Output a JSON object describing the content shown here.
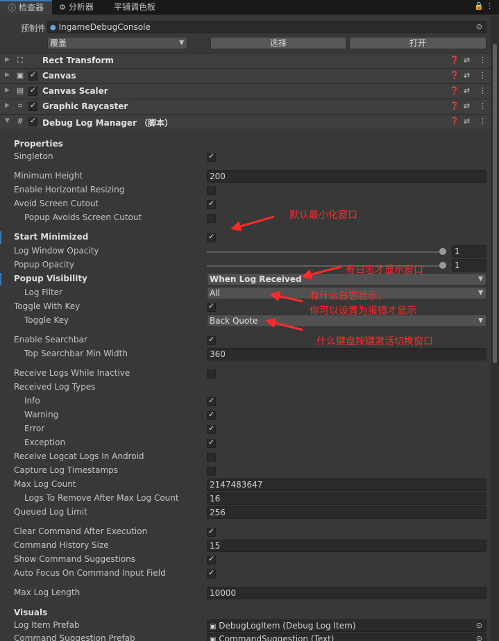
{
  "tabs": [
    {
      "label": "检查器",
      "icon": "inspector-icon"
    },
    {
      "label": "分析器",
      "icon": "analyzer-icon"
    },
    {
      "label": "平铺调色板",
      "icon": ""
    }
  ],
  "window_controls": {
    "lock": "🔒",
    "menu": "⋮"
  },
  "prefab": {
    "label": "预制件",
    "name": "IngameDebugConsole",
    "overrides_dropdown": "覆盖",
    "select_button": "选择",
    "open_button": "打开"
  },
  "components": [
    {
      "name": "Rect Transform",
      "checkbox": false,
      "icon": "rect-transform-icon"
    },
    {
      "name": "Canvas",
      "checkbox": true,
      "icon": "canvas-icon"
    },
    {
      "name": "Canvas Scaler",
      "checkbox": true,
      "icon": "canvas-scaler-icon"
    },
    {
      "name": "Graphic Raycaster",
      "checkbox": true,
      "icon": "graphic-raycaster-icon"
    },
    {
      "name": "Debug Log Manager （脚本）",
      "checkbox": true,
      "icon": "script-icon"
    }
  ],
  "properties": {
    "header": "Properties",
    "singleton": {
      "label": "Singleton",
      "checked": true
    },
    "minimum_height": {
      "label": "Minimum Height",
      "value": "200"
    },
    "enable_horizontal_resizing": {
      "label": "Enable Horizontal Resizing",
      "checked": false
    },
    "avoid_screen_cutout": {
      "label": "Avoid Screen Cutout",
      "checked": true
    },
    "popup_avoids_screen_cutout": {
      "label": "Popup Avoids Screen Cutout",
      "checked": false
    },
    "start_minimized": {
      "label": "Start Minimized",
      "checked": true
    },
    "log_window_opacity": {
      "label": "Log Window Opacity",
      "value": "1",
      "slider_fraction": 1.0
    },
    "popup_opacity": {
      "label": "Popup Opacity",
      "value": "1",
      "slider_fraction": 1.0
    },
    "popup_visibility": {
      "label": "Popup Visibility",
      "value": "When Log Received"
    },
    "log_filter": {
      "label": "Log Filter",
      "value": "All"
    },
    "toggle_with_key": {
      "label": "Toggle With Key",
      "checked": true
    },
    "toggle_key": {
      "label": "Toggle Key",
      "value": "Back Quote"
    },
    "enable_searchbar": {
      "label": "Enable Searchbar",
      "checked": true
    },
    "top_searchbar_min_width": {
      "label": "Top Searchbar Min Width",
      "value": "360"
    },
    "receive_logs_while_inactive": {
      "label": "Receive Logs While Inactive",
      "checked": false
    },
    "received_log_types": {
      "label": "Received Log Types"
    },
    "info": {
      "label": "Info",
      "checked": true
    },
    "warning": {
      "label": "Warning",
      "checked": true
    },
    "error": {
      "label": "Error",
      "checked": true
    },
    "exception": {
      "label": "Exception",
      "checked": true
    },
    "receive_logcat_logs": {
      "label": "Receive Logcat Logs In Android",
      "checked": false
    },
    "capture_log_timestamps": {
      "label": "Capture Log Timestamps",
      "checked": false
    },
    "max_log_count": {
      "label": "Max Log Count",
      "value": "2147483647"
    },
    "logs_to_remove": {
      "label": "Logs To Remove After Max Log Count",
      "value": "16"
    },
    "queued_log_limit": {
      "label": "Queued Log Limit",
      "value": "256"
    },
    "clear_command_after_execution": {
      "label": "Clear Command After Execution",
      "checked": true
    },
    "command_history_size": {
      "label": "Command History Size",
      "value": "15"
    },
    "show_command_suggestions": {
      "label": "Show Command Suggestions",
      "checked": true
    },
    "auto_focus_command_input": {
      "label": "Auto Focus On Command Input Field",
      "checked": true
    },
    "max_log_length": {
      "label": "Max Log Length",
      "value": "10000"
    }
  },
  "visuals": {
    "header": "Visuals",
    "log_item_prefab": {
      "label": "Log Item Prefab",
      "value": "DebugLogItem (Debug Log Item)"
    },
    "command_suggestion_prefab": {
      "label": "Command Suggestion Prefab",
      "value": "CommandSuggestion (Text)"
    }
  },
  "annotations": {
    "start_minimized": "默认最小化窗口",
    "popup_visibility": "有日志才显示窗口",
    "log_filter_line1": "有什么日志显示，",
    "log_filter_line2": "你可以设置为报错才显示",
    "toggle_key": "什么键盘按键激活切换窗口"
  },
  "colors": {
    "annotation": "#ff2a2a",
    "accent": "#3a79bb",
    "background": "#383838"
  }
}
